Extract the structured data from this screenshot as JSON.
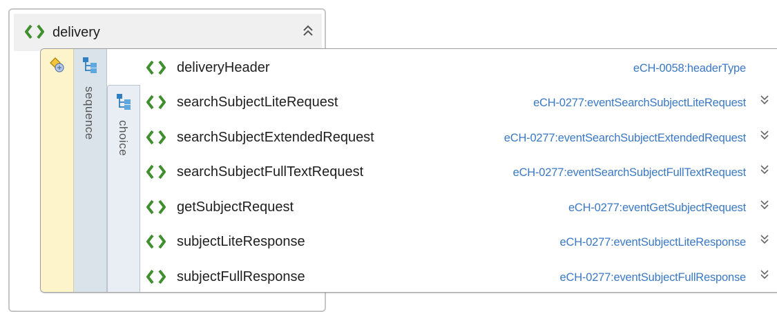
{
  "delivery": {
    "name": "delivery",
    "collapse_icon": "double-chevron-up-icon"
  },
  "compositors": {
    "sequence_label": "sequence",
    "choice_label": "choice"
  },
  "elements": [
    {
      "name": "deliveryHeader",
      "type": "eCH-0058:headerType",
      "expandable": false
    },
    {
      "name": "searchSubjectLiteRequest",
      "type": "eCH-0277:eventSearchSubjectLiteRequest",
      "expandable": true
    },
    {
      "name": "searchSubjectExtendedRequest",
      "type": "eCH-0277:eventSearchSubjectExtendedRequest",
      "expandable": true
    },
    {
      "name": "searchSubjectFullTextRequest",
      "type": "eCH-0277:eventSearchSubjectFullTextRequest",
      "expandable": true
    },
    {
      "name": "getSubjectRequest",
      "type": "eCH-0277:eventGetSubjectRequest",
      "expandable": true
    },
    {
      "name": "subjectLiteResponse",
      "type": "eCH-0277:eventSubjectLiteResponse",
      "expandable": true
    },
    {
      "name": "subjectFullResponse",
      "type": "eCH-0277:eventSubjectFullResponse",
      "expandable": true
    }
  ],
  "colors": {
    "element_icon": "#3f8f2f",
    "type_text": "#3a78c4",
    "compositor_strip": "#fdf4cb",
    "sequence_strip": "#dbe3ea"
  }
}
